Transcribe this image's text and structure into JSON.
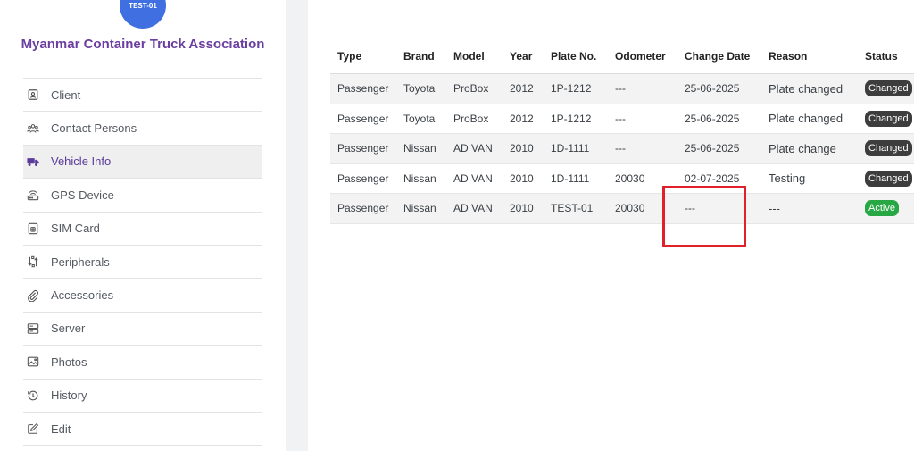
{
  "vehicle": {
    "avatar_label": "TEST-01"
  },
  "organization": {
    "name": "Myanmar Container Truck Association"
  },
  "sidebar": {
    "items": [
      {
        "label": "Client",
        "icon": "client-card-icon"
      },
      {
        "label": "Contact Persons",
        "icon": "people-icon"
      },
      {
        "label": "Vehicle Info",
        "icon": "truck-icon",
        "active": true
      },
      {
        "label": "GPS Device",
        "icon": "router-icon"
      },
      {
        "label": "SIM Card",
        "icon": "sim-card-icon"
      },
      {
        "label": "Peripherals",
        "icon": "transfer-icon"
      },
      {
        "label": "Accessories",
        "icon": "paperclip-icon"
      },
      {
        "label": "Server",
        "icon": "server-icon"
      },
      {
        "label": "Photos",
        "icon": "image-icon"
      },
      {
        "label": "History",
        "icon": "history-icon"
      },
      {
        "label": "Edit",
        "icon": "edit-icon"
      }
    ]
  },
  "table": {
    "headers": [
      "Type",
      "Brand",
      "Model",
      "Year",
      "Plate No.",
      "Odometer",
      "Change Date",
      "Reason",
      "Status"
    ],
    "rows": [
      {
        "type": "Passenger",
        "brand": "Toyota",
        "model": "ProBox",
        "year": "2012",
        "plate": "1P-1212",
        "odometer": "---",
        "change_date": "25-06-2025",
        "reason": "Plate changed",
        "status": "Changed"
      },
      {
        "type": "Passenger",
        "brand": "Toyota",
        "model": "ProBox",
        "year": "2012",
        "plate": "1P-1212",
        "odometer": "---",
        "change_date": "25-06-2025",
        "reason": "Plate changed",
        "status": "Changed"
      },
      {
        "type": "Passenger",
        "brand": "Nissan",
        "model": "AD VAN",
        "year": "2010",
        "plate": "1D-1111",
        "odometer": "---",
        "change_date": "25-06-2025",
        "reason": "Plate change",
        "status": "Changed"
      },
      {
        "type": "Passenger",
        "brand": "Nissan",
        "model": "AD VAN",
        "year": "2010",
        "plate": "1D-1111",
        "odometer": "20030",
        "change_date": "02-07-2025",
        "reason": "Testing",
        "status": "Changed"
      },
      {
        "type": "Passenger",
        "brand": "Nissan",
        "model": "AD VAN",
        "year": "2010",
        "plate": "TEST-01",
        "odometer": "20030",
        "change_date": "---",
        "reason": "---",
        "status": "Active"
      }
    ]
  },
  "colors": {
    "accent_purple": "#6b3fa0",
    "avatar_blue": "#3f6fe0",
    "badge_changed": "#3d3d3d",
    "badge_active": "#28a745",
    "highlight_red": "#e0202a"
  }
}
